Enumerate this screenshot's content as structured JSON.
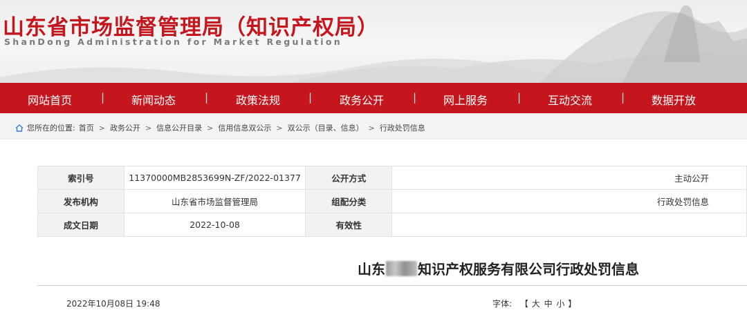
{
  "header": {
    "title": "山东省市场监督管理局（知识产权局）",
    "subtitle": "ShanDong Administration for Market Regulation"
  },
  "nav": {
    "items": [
      "网站首页",
      "新闻动态",
      "政策法规",
      "政务公开",
      "网上服务",
      "互动交流",
      "数据开放"
    ],
    "separator": "|"
  },
  "breadcrumb": {
    "prefix": "您所在的位置:",
    "items": [
      "首页",
      "政务公开",
      "信息公开目录",
      "信用信息双公示",
      "双公示（目录、信息）",
      "行政处罚信息"
    ],
    "separator": ">"
  },
  "info": {
    "index_label": "索引号",
    "index_value": "11370000MB2853699N-ZF/2022-01377",
    "publish_method_label": "公开方式",
    "publish_method_value": "主动公开",
    "issuer_label": "发布机构",
    "issuer_value": "山东省市场监督管理局",
    "category_label": "组配分类",
    "category_value": "行政处罚信息",
    "date_label": "成文日期",
    "date_value": "2022-10-08",
    "validity_label": "有效性",
    "validity_value": ""
  },
  "article": {
    "title_prefix": "山东",
    "title_suffix": "知识产权服务有限公司行政处罚信息",
    "publish_time": "2022年10月08日 19:48",
    "font_label": "字体:",
    "bracket_open": "【",
    "bracket_close": "】",
    "font_large": "大",
    "font_medium": "中",
    "font_small": "小"
  },
  "colors": {
    "brand_red": "#c4161c",
    "breadcrumb_bg": "#f3f3f3",
    "label_bg": "#f2f2f2"
  },
  "icons": {
    "location": "home-icon"
  }
}
